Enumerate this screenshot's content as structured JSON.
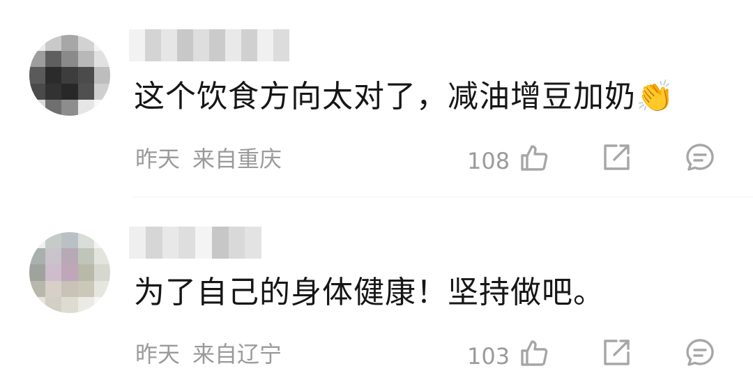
{
  "comments": [
    {
      "text": "这个饮食方向太对了，减油增豆加奶👏",
      "time": "昨天",
      "location": "来自重庆",
      "likes": "108"
    },
    {
      "text": "为了自己的身体健康！坚持做吧。",
      "time": "昨天",
      "location": "来自辽宁",
      "likes": "103"
    }
  ],
  "icons": {
    "like": "thumbs-up-icon",
    "share": "share-icon",
    "reply": "reply-icon"
  },
  "colors": {
    "text": "#161616",
    "meta": "#9a9a9a",
    "icon": "#a6a6a6"
  }
}
